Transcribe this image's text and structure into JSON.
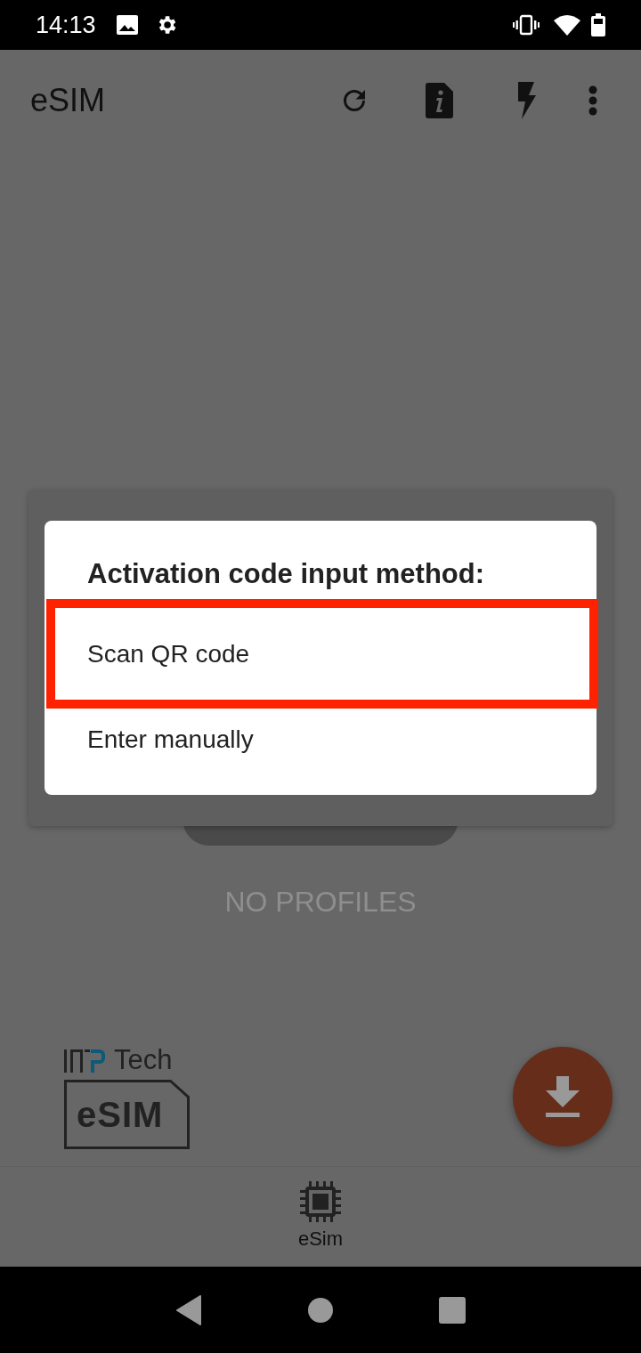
{
  "status_bar": {
    "time": "14:13"
  },
  "app_bar": {
    "title": "eSIM"
  },
  "empty_state": "NO PROFILES",
  "logo": {
    "brand": "Tech",
    "label": "eSIM"
  },
  "bottom_nav": [
    {
      "label": "eSim"
    }
  ],
  "dialog": {
    "title": "Activation code input method:",
    "options": [
      {
        "label": "Scan QR code",
        "highlighted": true
      },
      {
        "label": "Enter manually",
        "highlighted": false
      }
    ]
  }
}
